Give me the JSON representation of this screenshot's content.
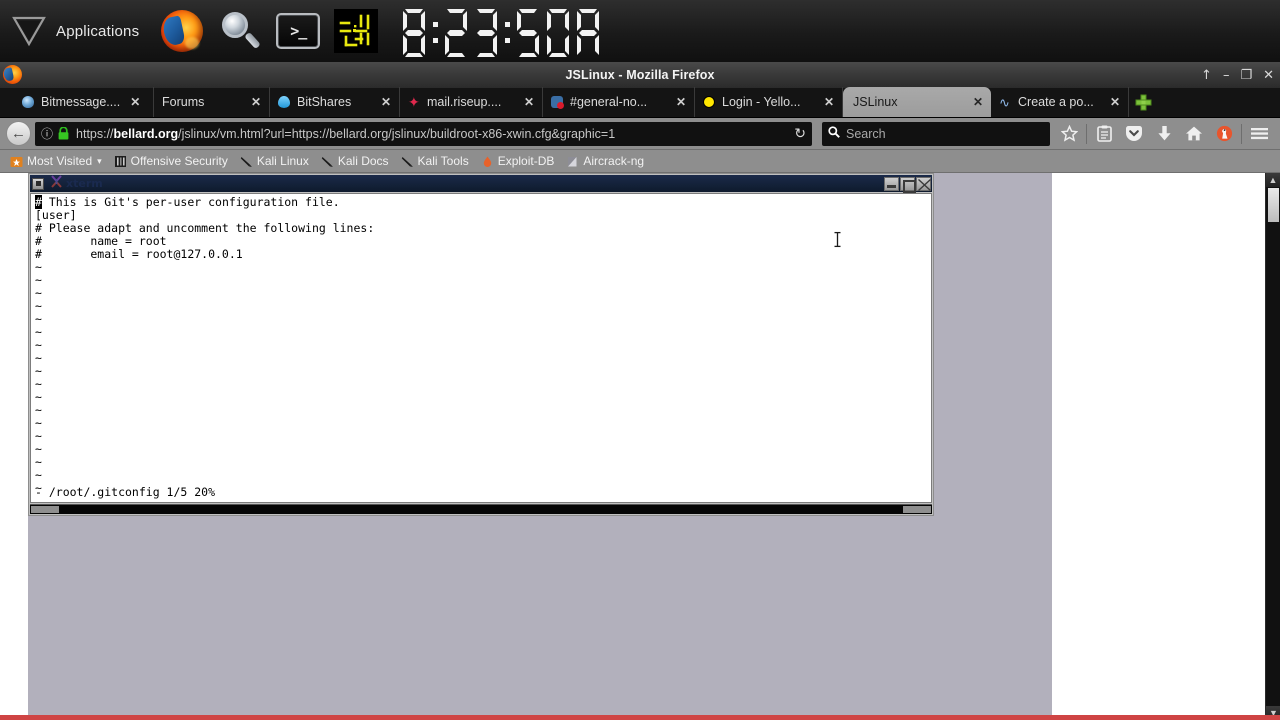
{
  "desktop_panel": {
    "menu_icon": "triangle-down-icon",
    "applications_label": "Applications",
    "launchers": [
      {
        "name": "firefox-launcher",
        "icon": "firefox-icon"
      },
      {
        "name": "search-launcher",
        "icon": "magnifier-icon"
      },
      {
        "name": "terminal-launcher",
        "icon": "terminal-icon",
        "glyph": ">_"
      },
      {
        "name": "calculator-launcher",
        "icon": "yellow-circuit-icon"
      }
    ],
    "clock": {
      "text": "8:23:50A",
      "digits": [
        "8",
        ":",
        "2",
        "3",
        ":",
        "5",
        "0",
        "A"
      ],
      "style": "seven-segment",
      "segment_color": "#f0f0f0",
      "background": "#111111"
    }
  },
  "browser": {
    "window_title": "JSLinux - Mozilla Firefox",
    "window_buttons": {
      "restore": "↑",
      "minimize": "–",
      "maximize": "❐",
      "close": "✕"
    },
    "tabs": [
      {
        "label": "Bitmessage....",
        "favicon": "bitmessage-icon",
        "active": false,
        "close": "✕"
      },
      {
        "label": "Forums",
        "favicon": "none",
        "active": false,
        "close": "✕"
      },
      {
        "label": "BitShares",
        "favicon": "bitshares-flame-icon",
        "active": false,
        "close": "✕"
      },
      {
        "label": "mail.riseup....",
        "favicon": "riseup-star-icon",
        "active": false,
        "close": "✕"
      },
      {
        "label": "#general-no...",
        "favicon": "riot-chat-icon",
        "active": false,
        "close": "✕"
      },
      {
        "label": "Login - Yello...",
        "favicon": "yellow-dot-icon",
        "active": false,
        "close": "✕"
      },
      {
        "label": "JSLinux",
        "favicon": "none",
        "active": true,
        "close": "✕"
      },
      {
        "label": "Create a po...",
        "favicon": "wave-icon",
        "active": false,
        "close": "✕"
      }
    ],
    "new_tab_label": "+",
    "navbar": {
      "back_icon": "back-arrow-icon",
      "back_glyph": "←",
      "identity_icon": "info-circle-icon",
      "lock_icon": "padlock-icon",
      "lock_color": "#34c924",
      "url_prefix": "https://",
      "url_domain": "bellard.org",
      "url_rest": "/jslinux/vm.html?url=https://bellard.org/jslinux/buildroot-x86-xwin.cfg&graphic=1",
      "url_full": "https://bellard.org/jslinux/vm.html?url=https://bellard.org/jslinux/buildroot-x86-xwin.cfg&graphic=1",
      "reload_icon": "reload-icon",
      "reload_glyph": "↻",
      "search_icon": "search-icon",
      "search_placeholder": "Search",
      "icons": [
        {
          "name": "bookmark-star-icon",
          "glyph": "☆"
        },
        {
          "name": "reader-list-icon",
          "glyph": "Ὄb"
        },
        {
          "name": "pocket-icon",
          "glyph": "▼"
        },
        {
          "name": "downloads-icon",
          "glyph": "↓"
        },
        {
          "name": "home-icon",
          "glyph": "⌂"
        },
        {
          "name": "duckduckgo-icon",
          "glyph": "●"
        },
        {
          "name": "hamburger-menu-icon",
          "glyph": "☰"
        }
      ]
    },
    "bookmarks": [
      {
        "label": "Most Visited",
        "icon": "folder-star-icon",
        "caret": "▾"
      },
      {
        "label": "Offensive Security",
        "icon": "offsec-icon",
        "caret": ""
      },
      {
        "label": "Kali Linux",
        "icon": "kali-dragon-icon",
        "caret": ""
      },
      {
        "label": "Kali Docs",
        "icon": "kali-dragon-icon",
        "caret": ""
      },
      {
        "label": "Kali Tools",
        "icon": "kali-dragon-icon",
        "caret": ""
      },
      {
        "label": "Exploit-DB",
        "icon": "exploitdb-icon",
        "caret": ""
      },
      {
        "label": "Aircrack-ng",
        "icon": "aircrack-icon",
        "caret": ""
      }
    ],
    "page_scrollbar": {
      "up_glyph": "▲",
      "down_glyph": "▼"
    }
  },
  "vm": {
    "desktop_background": "#b2b0bc",
    "xterm": {
      "window_title": "xterm",
      "menu_button": "window-menu-icon",
      "buttons": {
        "minimize": "minimize-icon",
        "maximize": "maximize-icon",
        "close": "close-icon"
      },
      "editor": "vi",
      "cursor_char": "#",
      "lines": [
        "# This is Git's per-user configuration file.",
        "[user]",
        "# Please adapt and uncomment the following lines:",
        "#\tname = root",
        "#\temail = root@127.0.0.1",
        "~",
        "~",
        "~",
        "~",
        "~",
        "~",
        "~",
        "~",
        "~",
        "~",
        "~",
        "~",
        "~",
        "~",
        "~",
        "~",
        "~",
        "~"
      ],
      "first_line_head": "#",
      "first_line_tail": " This is Git's per-user configuration file.",
      "body_lines": [
        "[user]",
        "# Please adapt and uncomment the following lines:",
        "#       name = root",
        "#       email = root@127.0.0.1",
        "~",
        "~",
        "~",
        "~",
        "~",
        "~",
        "~",
        "~",
        "~",
        "~",
        "~",
        "~",
        "~",
        "~",
        "~",
        "~",
        "~",
        "~"
      ],
      "status_line": "- /root/.gitconfig 1/5 20%"
    }
  }
}
